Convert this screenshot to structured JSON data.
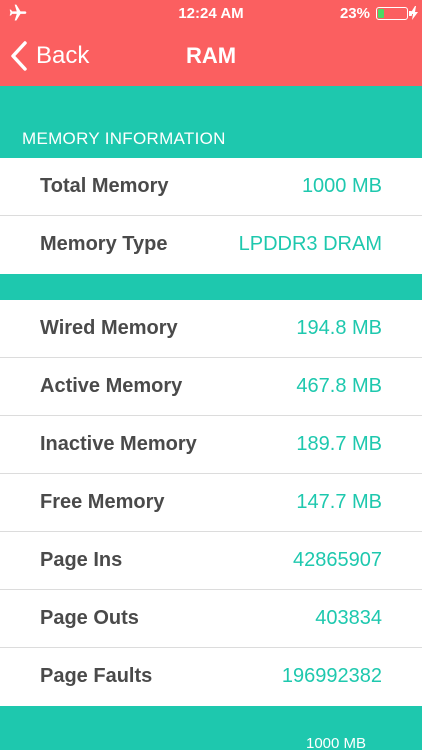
{
  "status_bar": {
    "time": "12:24 AM",
    "battery_percent": "23%",
    "battery_level": 0.23,
    "airplane_icon": "airplane-icon",
    "charging_icon": "bolt-icon"
  },
  "nav": {
    "back_label": "Back",
    "title": "RAM"
  },
  "section1": {
    "header": "MEMORY INFORMATION",
    "rows": [
      {
        "label": "Total Memory",
        "value": "1000 MB"
      },
      {
        "label": "Memory Type",
        "value": "LPDDR3 DRAM"
      }
    ]
  },
  "section2": {
    "rows": [
      {
        "label": "Wired Memory",
        "value": "194.8 MB"
      },
      {
        "label": "Active Memory",
        "value": "467.8 MB"
      },
      {
        "label": "Inactive Memory",
        "value": "189.7 MB"
      },
      {
        "label": "Free Memory",
        "value": "147.7 MB"
      },
      {
        "label": "Page Ins",
        "value": "42865907"
      },
      {
        "label": "Page Outs",
        "value": "403834"
      },
      {
        "label": "Page Faults",
        "value": "196992382"
      }
    ]
  },
  "footer": {
    "text": "1000 MB"
  },
  "colors": {
    "nav_red": "#fb5f60",
    "accent_teal": "#1ec8ae",
    "label_gray": "#4a4a4a"
  }
}
